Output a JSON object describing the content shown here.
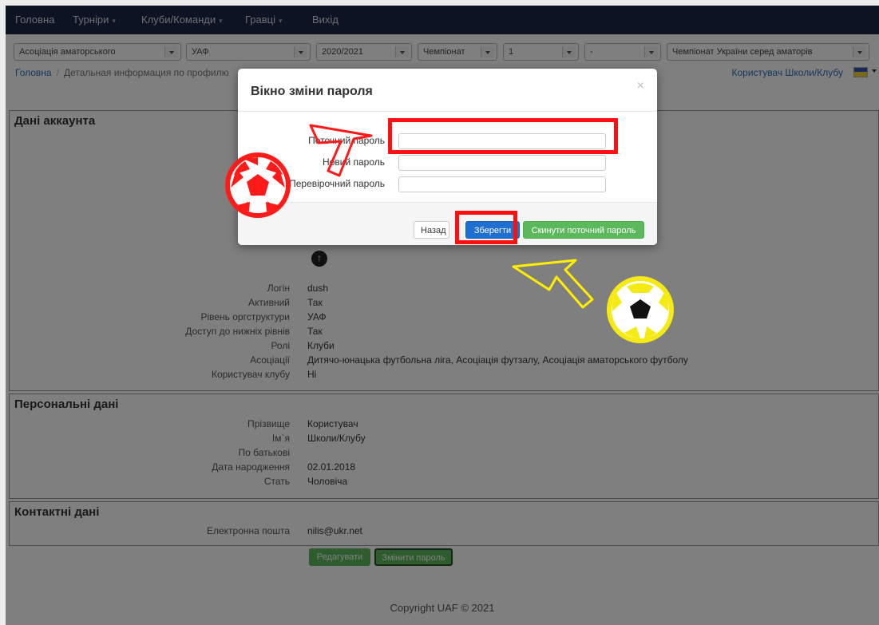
{
  "nav": {
    "items": [
      {
        "label": "Головна",
        "caret": false
      },
      {
        "label": "Турніри",
        "caret": true
      },
      {
        "label": "Клуби/Команди",
        "caret": true
      },
      {
        "label": "Гравці",
        "caret": true
      },
      {
        "label": "Вихід",
        "caret": false
      }
    ]
  },
  "filters": {
    "association": "Асоціація аматорського",
    "level": "УАФ",
    "season": "2020/2021",
    "type": "Чемпіонат",
    "number": "1",
    "extra": "-",
    "competition": "Чемпіонат України серед аматорів"
  },
  "breadcrumb": {
    "home": "Головна",
    "current": "Детальная информация по профилю"
  },
  "user": {
    "name": "Користувач Школи/Клубу"
  },
  "account": {
    "title": "Дані аккаунта",
    "fields": [
      {
        "label": "Логін",
        "value": "dush"
      },
      {
        "label": "Активний",
        "value": "Так"
      },
      {
        "label": "Рівень оргструктури",
        "value": "УАФ"
      },
      {
        "label": "Доступ до нижніх рівнів",
        "value": "Так"
      },
      {
        "label": "Ролі",
        "value": "Клуби"
      },
      {
        "label": "Асоціації",
        "value": "Дитячо-юнацька футбольна ліга, Асоціація футзалу, Асоціація аматорського футболу"
      },
      {
        "label": "Користувач клубу",
        "value": "Ні"
      }
    ]
  },
  "personal": {
    "title": "Персональні дані",
    "fields": [
      {
        "label": "Прізвище",
        "value": "Користувач"
      },
      {
        "label": "Ім`я",
        "value": "Школи/Клубу"
      },
      {
        "label": "По батькові",
        "value": ""
      },
      {
        "label": "Дата народження",
        "value": "02.01.2018"
      },
      {
        "label": "Стать",
        "value": "Чоловіча"
      }
    ]
  },
  "contacts": {
    "title": "Контактні дані",
    "fields": [
      {
        "label": "Електронна пошта",
        "value": "nilis@ukr.net"
      }
    ]
  },
  "actions": {
    "edit": "Редагувати",
    "change_password": "Змінити пароль"
  },
  "footer": {
    "copyright": "Copyright UAF ©  2021"
  },
  "modal": {
    "title": "Вікно зміни пароля",
    "close": "×",
    "current_password_label": "Поточний пароль",
    "new_password_label": "Новий пароль",
    "confirm_password_label": "Перевірочний пароль",
    "current_password_value": "",
    "new_password_value": "",
    "confirm_password_value": "",
    "back_button": "Назад",
    "save_button": "Зберегти",
    "reset_button": "Скинути поточний пароль"
  },
  "annotations": {
    "highlight_color": "#ff1010",
    "red_ball_icon": "soccer-ball-red-icon",
    "yellow_ball_icon": "soccer-ball-yellow-icon",
    "red_arrow_icon": "arrow-red-icon",
    "yellow_arrow_icon": "arrow-yellow-icon"
  }
}
